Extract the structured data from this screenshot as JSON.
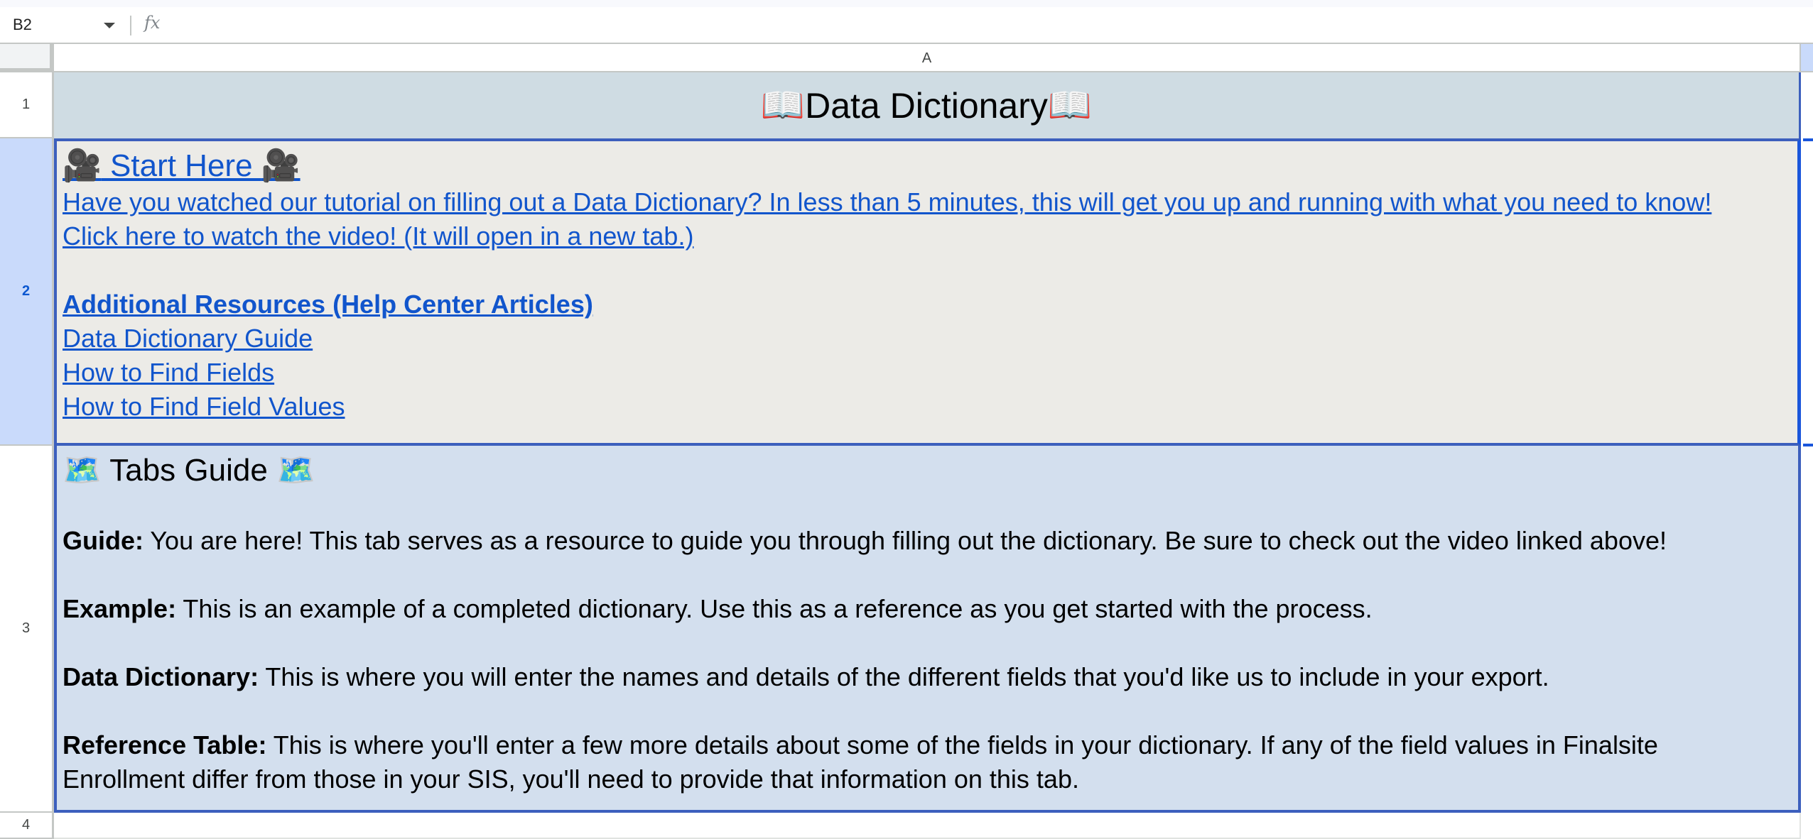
{
  "formula_bar": {
    "name_box": "B2",
    "fx_label": "fx",
    "formula_value": ""
  },
  "columns": [
    "A"
  ],
  "rows": [
    "1",
    "2",
    "3",
    "4"
  ],
  "selected_cell": "B2",
  "colors": {
    "title_bg": "#cfdce3",
    "resources_bg": "#ecebe7",
    "tabs_bg": "#d3dfee",
    "link": "#1155cc",
    "selection": "#1a56db",
    "border_accent": "#3c5fbd"
  },
  "cells": {
    "A1": {
      "icon_left": "📖",
      "title": "Data Dictionary",
      "icon_right": "📖"
    },
    "A2": {
      "start_here": {
        "icon_left": "🎥",
        "label": " Start Here ",
        "icon_right": "🎥"
      },
      "tutorial_link": "Have you watched our tutorial on filling out a Data Dictionary? In less than 5 minutes, this will get you up and running with what you need to know!",
      "video_link": "Click here to watch the video! (It will open in a new tab.)",
      "resources_heading": "Additional Resources (Help Center Articles)",
      "resource_links": [
        "Data Dictionary Guide",
        "How to Find Fields",
        "How to Find Field Values"
      ]
    },
    "A3": {
      "heading": {
        "icon_left": "🗺️",
        "label": " Tabs Guide ",
        "icon_right": "🗺️"
      },
      "entries": [
        {
          "term": "Guide:",
          "text": " You are here! This tab serves as a resource to guide you through filling out the dictionary. Be sure to check out the video linked above!"
        },
        {
          "term": "Example:",
          "text": " This is an example of a completed dictionary. Use this as a reference as you get started with the process."
        },
        {
          "term": "Data Dictionary:",
          "text": " This is where you will enter the names and details of the different fields that you'd like us to include in your export."
        },
        {
          "term": "Reference Table:",
          "text": " This is where you'll enter a few more details about some of the fields in your dictionary. If any of the field values in Finalsite Enrollment differ from those in your SIS, you'll need to provide that information on this tab."
        }
      ]
    },
    "A4": {
      "value": ""
    }
  }
}
